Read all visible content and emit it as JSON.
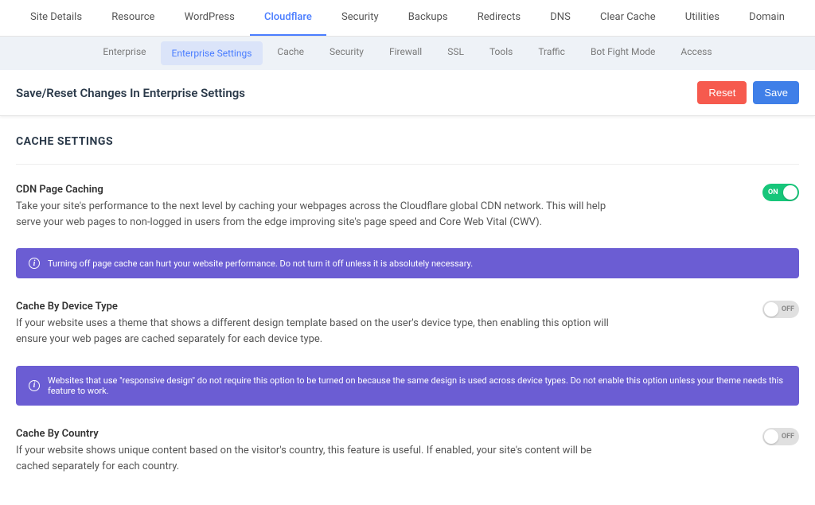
{
  "topTabs": {
    "items": [
      {
        "label": "Site Details"
      },
      {
        "label": "Resource"
      },
      {
        "label": "WordPress"
      },
      {
        "label": "Cloudflare",
        "active": true
      },
      {
        "label": "Security"
      },
      {
        "label": "Backups"
      },
      {
        "label": "Redirects"
      },
      {
        "label": "DNS"
      },
      {
        "label": "Clear Cache"
      },
      {
        "label": "Utilities"
      },
      {
        "label": "Domain"
      }
    ]
  },
  "subTabs": {
    "items": [
      {
        "label": "Enterprise"
      },
      {
        "label": "Enterprise Settings",
        "active": true
      },
      {
        "label": "Cache"
      },
      {
        "label": "Security"
      },
      {
        "label": "Firewall"
      },
      {
        "label": "SSL"
      },
      {
        "label": "Tools"
      },
      {
        "label": "Traffic"
      },
      {
        "label": "Bot Fight Mode"
      },
      {
        "label": "Access"
      }
    ]
  },
  "actionBar": {
    "title": "Save/Reset Changes In Enterprise Settings",
    "reset": "Reset",
    "save": "Save"
  },
  "section": {
    "title": "CACHE SETTINGS"
  },
  "settings": {
    "cdn": {
      "label": "CDN Page Caching",
      "desc": "Take your site's performance to the next level by caching your webpages across the Cloudflare global CDN network. This will help serve your web pages to non-logged in users from the edge improving site's page speed and Core Web Vital (CWV).",
      "toggle": "ON",
      "notice": "Turning off page cache can hurt your website performance. Do not turn it off unless it is absolutely necessary."
    },
    "device": {
      "label": "Cache By Device Type",
      "desc": "If your website uses a theme that shows a different design template based on the user's device type, then enabling this option will ensure your web pages are cached separately for each device type.",
      "toggle": "OFF",
      "notice": "Websites that use \"responsive design\" do not require this option to be turned on because the same design is used across device types. Do not enable this option unless your theme needs this feature to work."
    },
    "country": {
      "label": "Cache By Country",
      "desc": "If your website shows unique content based on the visitor's country, this feature is useful. If enabled, your site's content will be cached separately for each country.",
      "toggle": "OFF"
    }
  }
}
